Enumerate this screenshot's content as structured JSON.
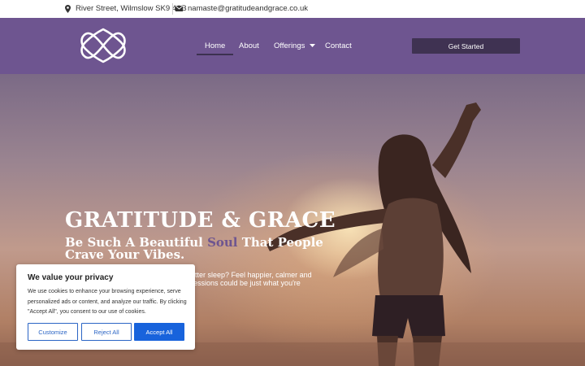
{
  "topbar": {
    "address": "River Street, Wilmslow SK9 4AB",
    "email": "namaste@gratitudeandgrace.co.uk"
  },
  "nav": {
    "items": [
      {
        "label": "Home"
      },
      {
        "label": "About"
      },
      {
        "label": "Offerings"
      },
      {
        "label": "Contact"
      }
    ],
    "cta": "Get Started"
  },
  "hero": {
    "title": "GRATITUDE & GRACE",
    "tagline_before": "Be Such A Beautiful ",
    "tagline_highlight": "Soul",
    "tagline_after": " That People Crave Your Vibes.",
    "description_line1": "better sleep? Feel happier, calmer and",
    "description_line2": "essions could be just what you're"
  },
  "cookie": {
    "title": "We value your privacy",
    "text": "We use cookies to enhance your browsing experience, serve personalized ads or content, and analyze our traffic. By clicking \"Accept All\", you consent to our use of cookies.",
    "customize": "Customize",
    "reject": "Reject All",
    "accept": "Accept All"
  },
  "colors": {
    "brand_purple": "#6e5590",
    "cta_dark": "#3f3252",
    "accept_blue": "#1863dc"
  },
  "icons": [
    "map-pin-icon",
    "envelope-icon",
    "chevron-down-icon",
    "infinity-heart-logo"
  ]
}
